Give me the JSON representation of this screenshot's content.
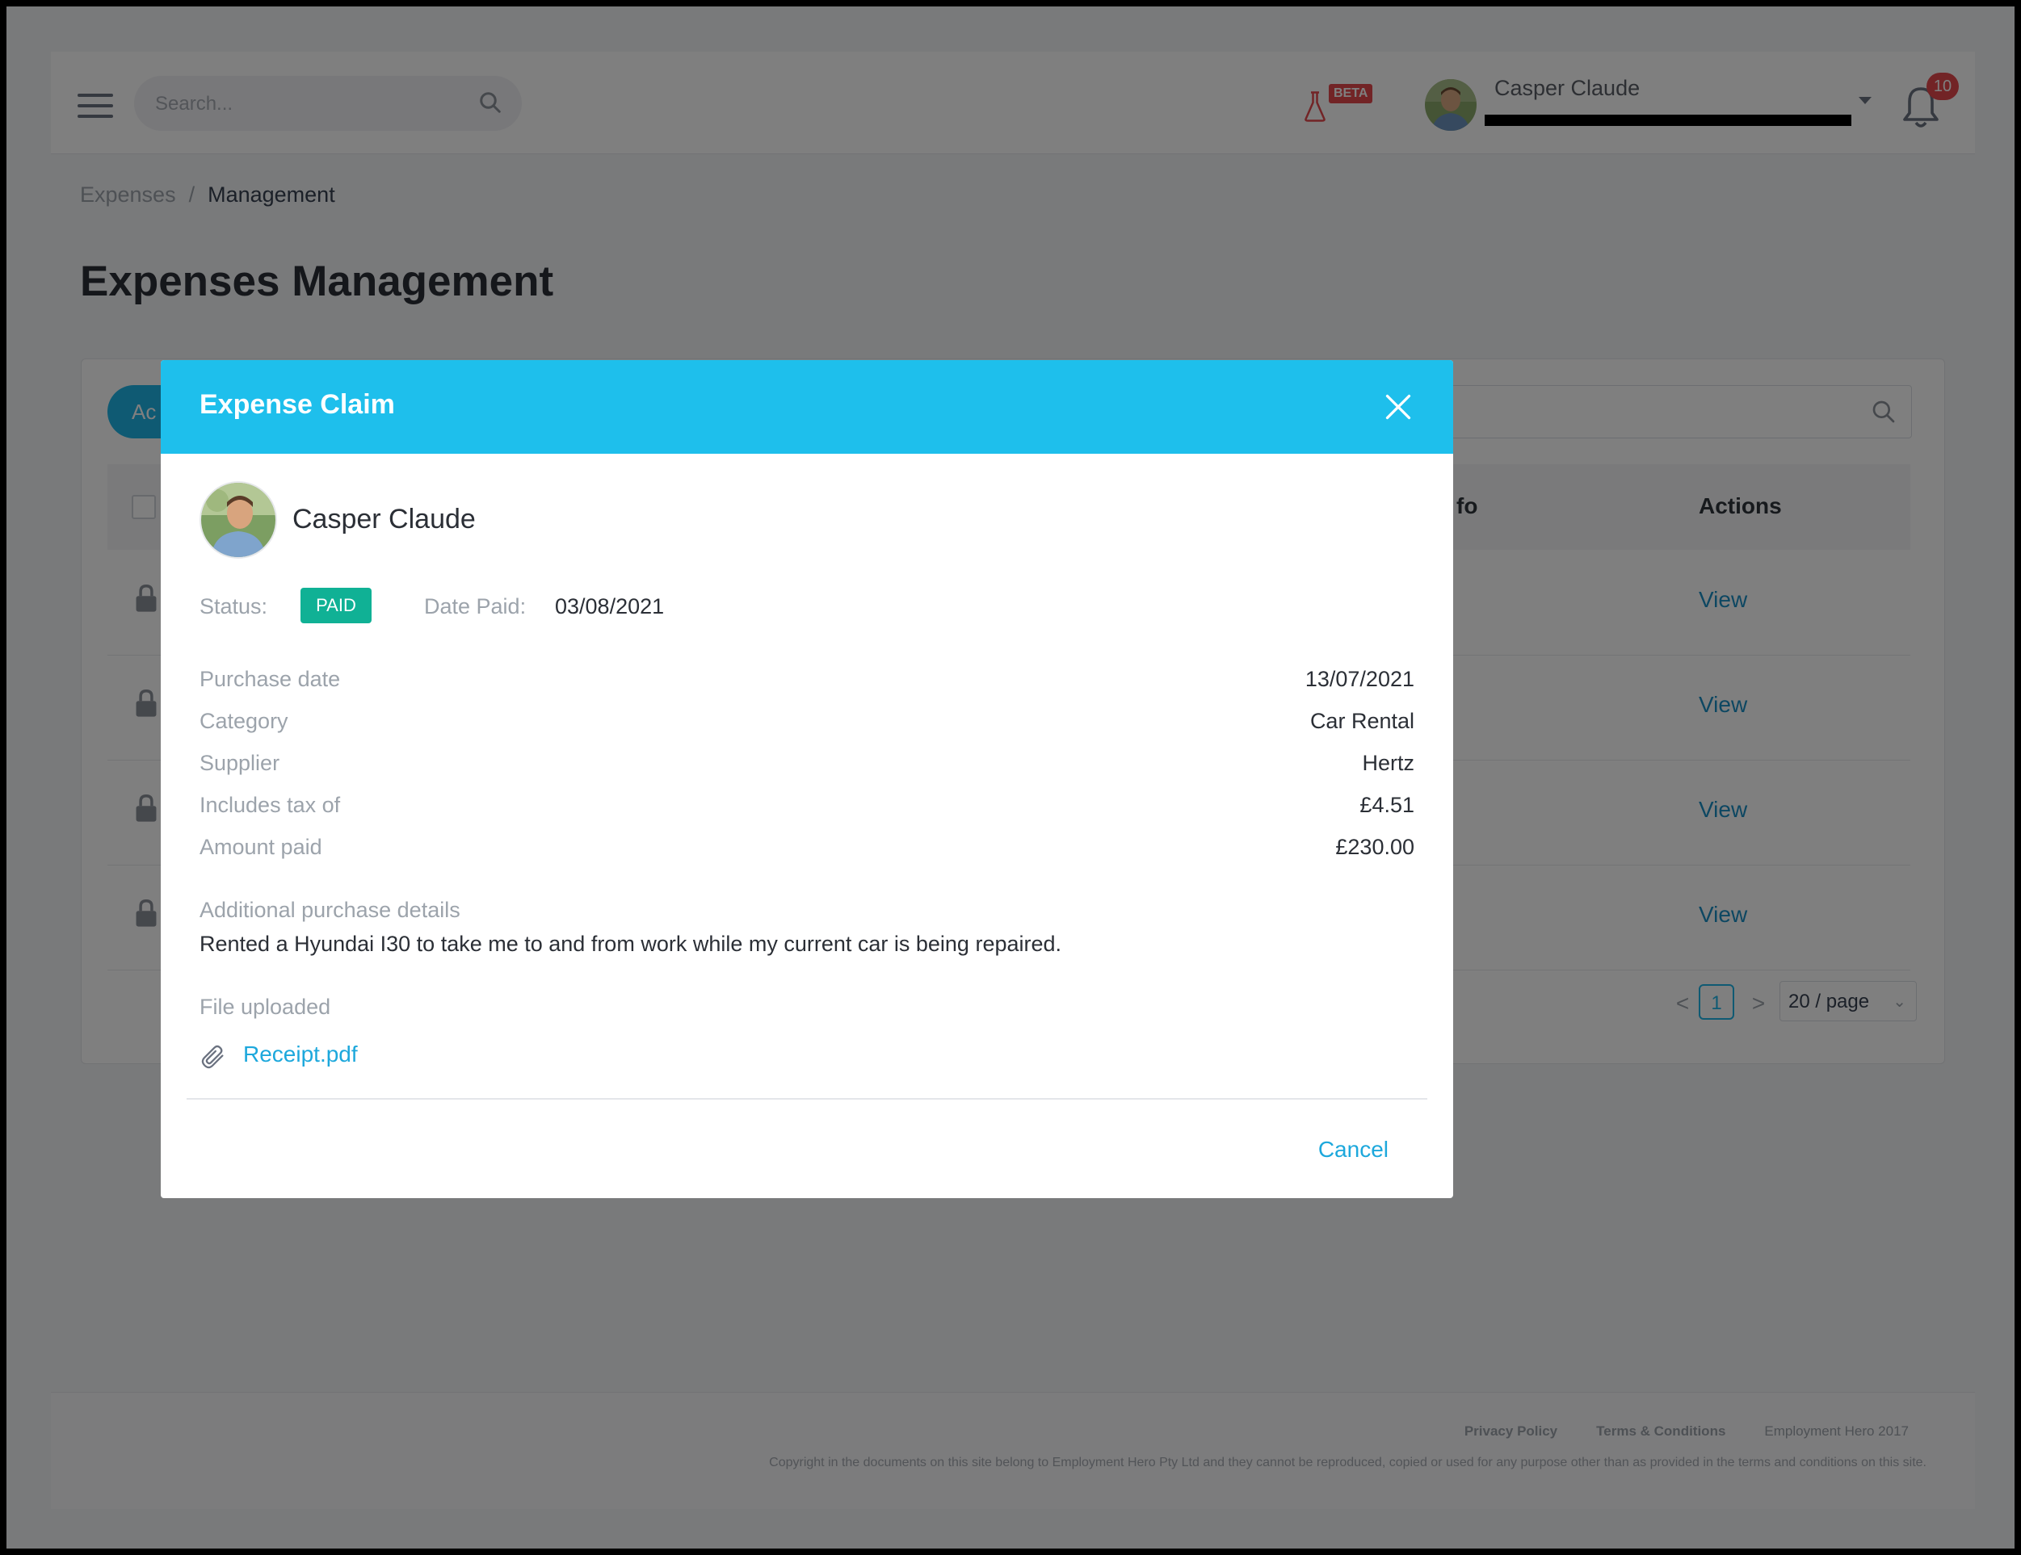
{
  "header": {
    "search_placeholder": "Search...",
    "beta_label": "BETA",
    "user_name": "Casper Claude",
    "notification_count": "10"
  },
  "breadcrumb": {
    "items": [
      "Expenses",
      "Management"
    ],
    "separator": "/"
  },
  "page": {
    "title": "Expenses Management"
  },
  "table": {
    "action_button_partial": "Ac",
    "columns": {
      "info_partial": "fo",
      "actions": "Actions"
    },
    "rows": [
      {
        "action": "View"
      },
      {
        "action": "View"
      },
      {
        "action": "View"
      },
      {
        "action": "View"
      }
    ],
    "pagination": {
      "prev": "<",
      "current_page": "1",
      "next": ">",
      "page_size": "20 / page"
    }
  },
  "footer": {
    "links": [
      "Privacy Policy",
      "Terms & Conditions",
      "Employment Hero 2017"
    ],
    "copyright": "Copyright in the documents on this site belong to Employment Hero Pty Ltd and they cannot be reproduced, copied or used for any purpose other than as provided in the terms and conditions on this site."
  },
  "modal": {
    "title": "Expense Claim",
    "employee_name": "Casper Claude",
    "status_label": "Status:",
    "status_value": "PAID",
    "date_paid_label": "Date Paid:",
    "date_paid_value": "03/08/2021",
    "details": [
      {
        "label": "Purchase date",
        "value": "13/07/2021"
      },
      {
        "label": "Category",
        "value": "Car Rental"
      },
      {
        "label": "Supplier",
        "value": "Hertz"
      },
      {
        "label": "Includes tax of",
        "value": "£4.51"
      },
      {
        "label": "Amount paid",
        "value": "£230.00"
      }
    ],
    "additional_label": "Additional purchase details",
    "additional_text": "Rented a Hyundai I30 to take me to and from work while my current car is being repaired.",
    "file_label": "File uploaded",
    "file_name": "Receipt.pdf",
    "cancel_label": "Cancel"
  },
  "colors": {
    "modal_header": "#1ebfec",
    "status_paid": "#10b195",
    "link": "#1da8dc",
    "badge": "#e5484d"
  }
}
